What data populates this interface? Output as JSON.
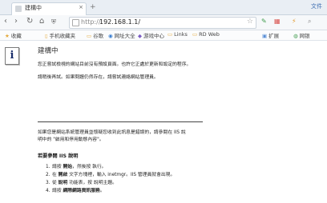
{
  "browser": {
    "tab_title": "建構中",
    "tab_close": "×",
    "new_tab": "+",
    "file_menu": "文件",
    "url_scheme": "http://",
    "url_host": "192.168.1.1/",
    "nav": {
      "back": "‹",
      "forward": "›",
      "refresh": "↻",
      "home": "⌂"
    },
    "bookmarks": {
      "favorites": "收藏",
      "mobile_favorites": "手机收藏夹",
      "google": "谷歌",
      "website_all": "网址大全",
      "game_center": "游戏中心",
      "links": "Links",
      "rd_web": "RD Web",
      "extensions": "扩展",
      "netbank": "网银"
    }
  },
  "page": {
    "icon_letter": "i",
    "heading": "建構中",
    "paragraph1": "您正嘗試檢視的網站目前沒有預設頁面。也許它正處於更新和設定的程序。",
    "paragraph2": "請稍後再試。如果問題仍然存在，請嘗試連絡網站管理員。",
    "paragraph3_line1": "如果您是網站系統管理員並懷疑您收到此訊息是錯誤的，請參閱在 IIS 說",
    "paragraph3_line2": "明中的 \"啟用和停用動態內容\"。",
    "subheading": "若要參閱 IIS 說明",
    "steps": [
      {
        "num": "1.",
        "pre": "請按 ",
        "bold": "開始",
        "post": "，然後按 執行。"
      },
      {
        "num": "2.",
        "pre": "在 ",
        "bold": "開啟",
        "post": " 文字方塊裡，輸入 inetmgr。IIS 管理員就會出現。"
      },
      {
        "num": "3.",
        "pre": "從 ",
        "bold": "說明",
        "post": " 功能表，按 說明主題。"
      },
      {
        "num": "4.",
        "pre": "請按 ",
        "bold": "網際網路資訊服務",
        "post": "。"
      }
    ]
  }
}
